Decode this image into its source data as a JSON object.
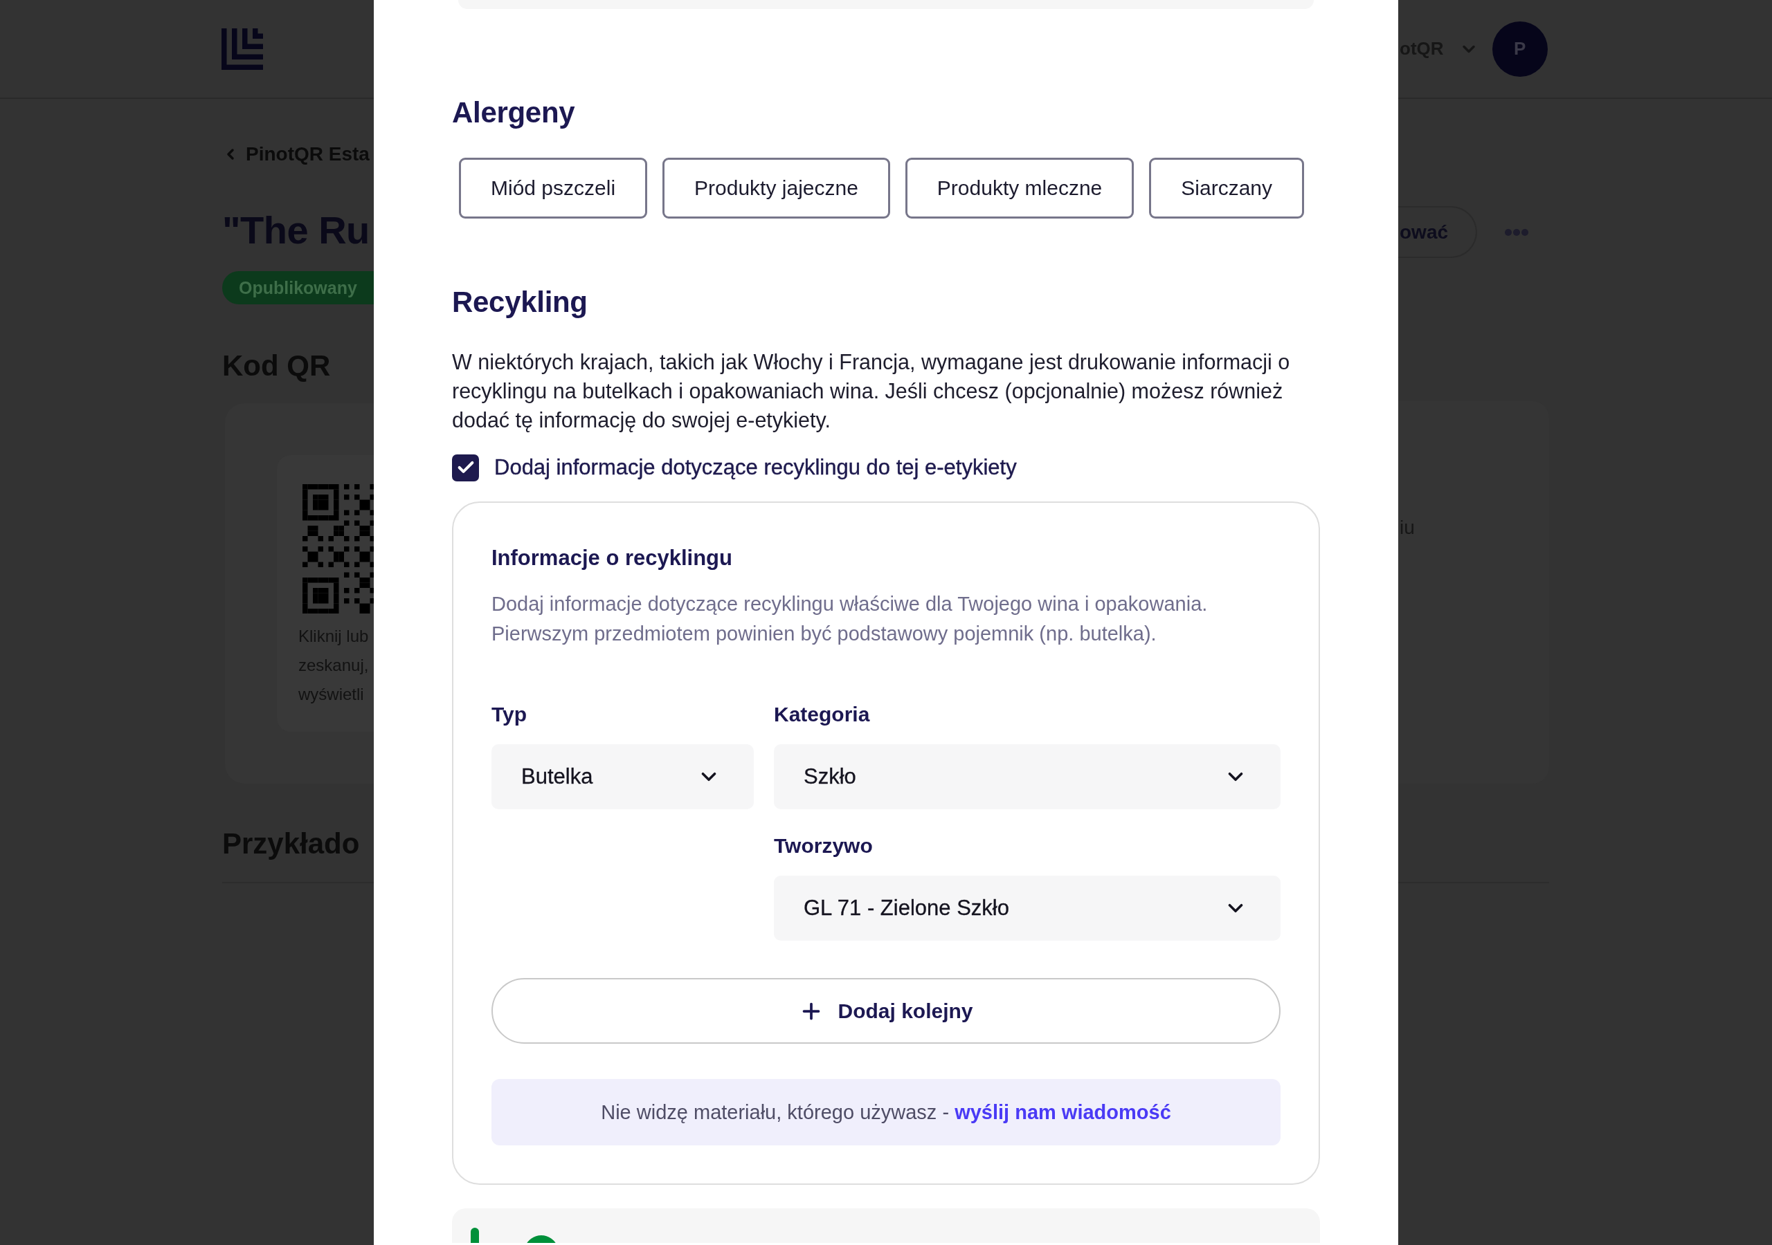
{
  "background_page": {
    "header": {
      "account_name": "otQR",
      "avatar_initial": "P"
    },
    "breadcrumb": "PinotQR Esta",
    "title": "\"The Ru",
    "status_badge": "Opublikowany",
    "action_button": "ować",
    "qr_section": {
      "heading": "Kod QR",
      "caption_lines": [
        "Kliknij lub",
        "zeskanuj,",
        "wyświetli"
      ],
      "side_text": "iu"
    },
    "examples_heading": "Przykłado"
  },
  "modal": {
    "allergens": {
      "heading": "Alergeny",
      "items": [
        {
          "label": "Miód pszczeli"
        },
        {
          "label": "Produkty jajeczne"
        },
        {
          "label": "Produkty mleczne"
        },
        {
          "label": "Siarczany"
        }
      ]
    },
    "recycling": {
      "heading": "Recykling",
      "description": "W niektórych krajach, takich jak Włochy i Francja, wymagane jest drukowanie informacji o recyklingu na butelkach i opakowaniach wina. Jeśli chcesz (opcjonalnie) możesz również dodać tę informację do swojej e-etykiety.",
      "checkbox": {
        "label": "Dodaj informacje dotyczące recyklingu do tej e-etykiety",
        "checked": true
      },
      "info_card": {
        "title": "Informacje o recyklingu",
        "description": "Dodaj informacje dotyczące recyklingu właściwe dla Twojego wina i opakowania. Pierwszym przedmiotem powinien być podstawowy pojemnik (np. butelka).",
        "items": [
          {
            "type": {
              "label": "Typ",
              "value": "Butelka"
            },
            "category": {
              "label": "Kategoria",
              "value": "Szkło"
            },
            "material": {
              "label": "Tworzywo",
              "value": "GL 71 - Zielone Szkło"
            }
          }
        ],
        "add_button": "Dodaj kolejny",
        "notice": {
          "text": "Nie widzę materiału, którego używasz - ",
          "link": "wyślij nam wiadomość"
        }
      }
    }
  }
}
